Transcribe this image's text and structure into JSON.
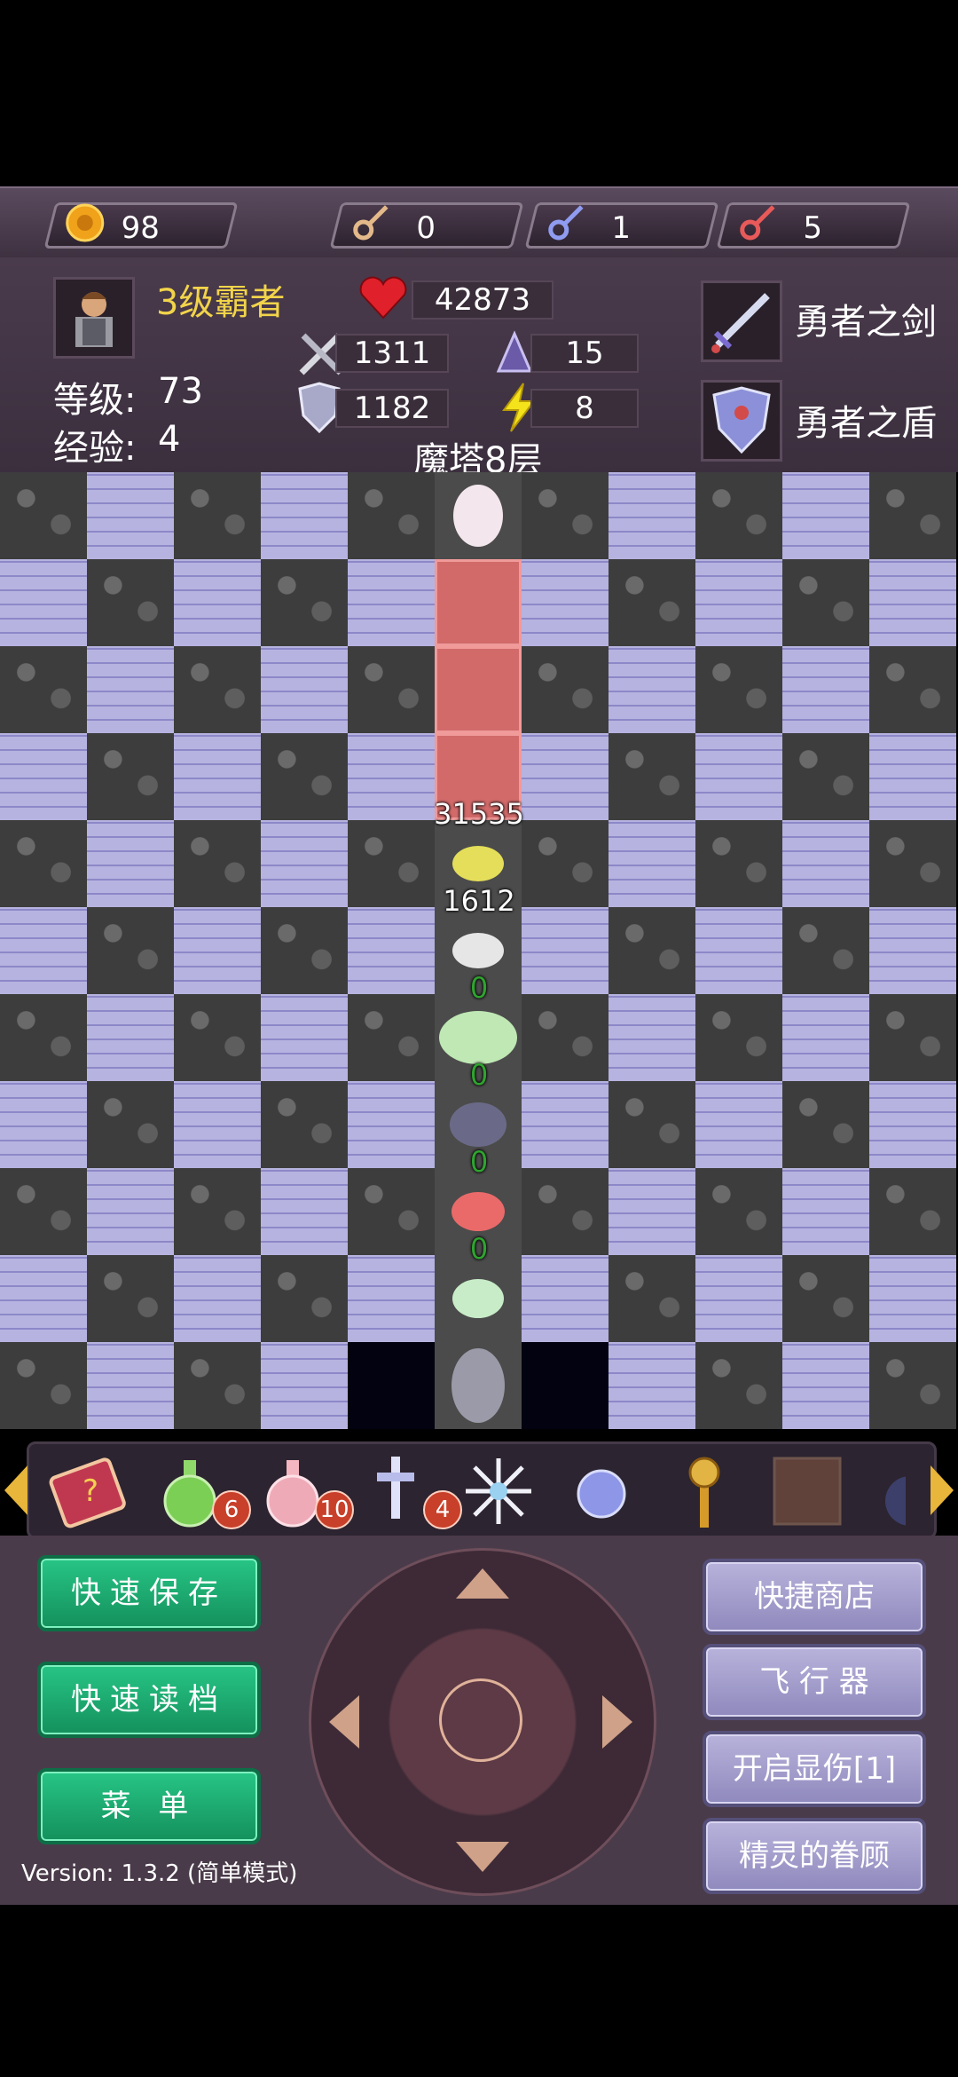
{
  "resources": {
    "gold": "98",
    "yellow_key": "0",
    "blue_key": "1",
    "red_key": "5"
  },
  "hero": {
    "title": "3级霸者",
    "level_label": "等级:",
    "level": "73",
    "exp_label": "经验:",
    "exp": "4",
    "hp": "42873",
    "attack": "1311",
    "defense": "1182",
    "magic_def": "15",
    "speed": "8"
  },
  "equipment": {
    "weapon": "勇者之剑",
    "armor": "勇者之盾"
  },
  "floor_title": "魔塔8层",
  "damage": {
    "boss": "31535",
    "yellow_mob": "1612",
    "white_mob": "0",
    "green_mob": "0",
    "dark_mob": "0",
    "red_mob": "0"
  },
  "items": {
    "potion_green_count": "6",
    "potion_pink_count": "10",
    "sword_count": "4"
  },
  "buttons": {
    "save": "快速保存",
    "load": "快速读档",
    "menu": "菜 单",
    "shop": "快捷商店",
    "fly": "飞 行 器",
    "damage_toggle": "开启显伤[1]",
    "fairy": "精灵的眷顾"
  },
  "version": "Version: 1.3.2 (简单模式)",
  "colors": {
    "gold_text": "#f2d44a",
    "zero_damage": "#2fa42f",
    "save_btn": "#1fb576",
    "side_btn": "#a6a1cf"
  }
}
